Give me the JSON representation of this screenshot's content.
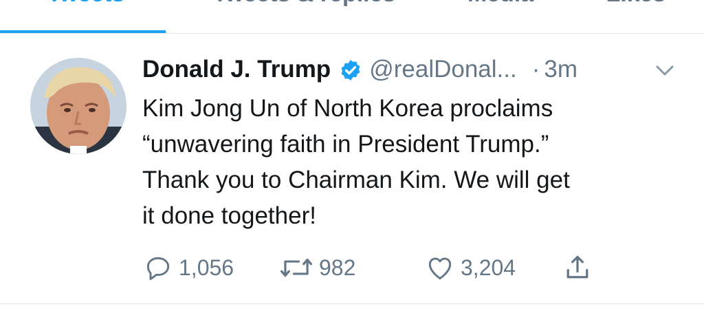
{
  "tabs": [
    {
      "label": "Tweets",
      "active": true
    },
    {
      "label": "Tweets & replies",
      "active": false
    },
    {
      "label": "Media",
      "active": false
    },
    {
      "label": "Likes",
      "active": false
    }
  ],
  "tweet": {
    "author_name": "Donald J. Trump",
    "verified": true,
    "handle": "@realDonal...",
    "separator": "·",
    "time": "3m",
    "text_lines": [
      "Kim Jong Un of North Korea proclaims",
      "“unwavering faith in President Trump.”",
      "Thank you to Chairman Kim. We will get",
      "it done together!"
    ],
    "actions": {
      "reply_count": "1,056",
      "retweet_count": "982",
      "like_count": "3,204"
    }
  },
  "colors": {
    "accent": "#1da1f2",
    "secondary_text": "#657786",
    "primary_text": "#14171a",
    "divider": "#e1e8ed"
  },
  "icons": [
    "verified-badge-icon",
    "chevron-down-icon",
    "reply-icon",
    "retweet-icon",
    "like-icon",
    "share-icon"
  ]
}
